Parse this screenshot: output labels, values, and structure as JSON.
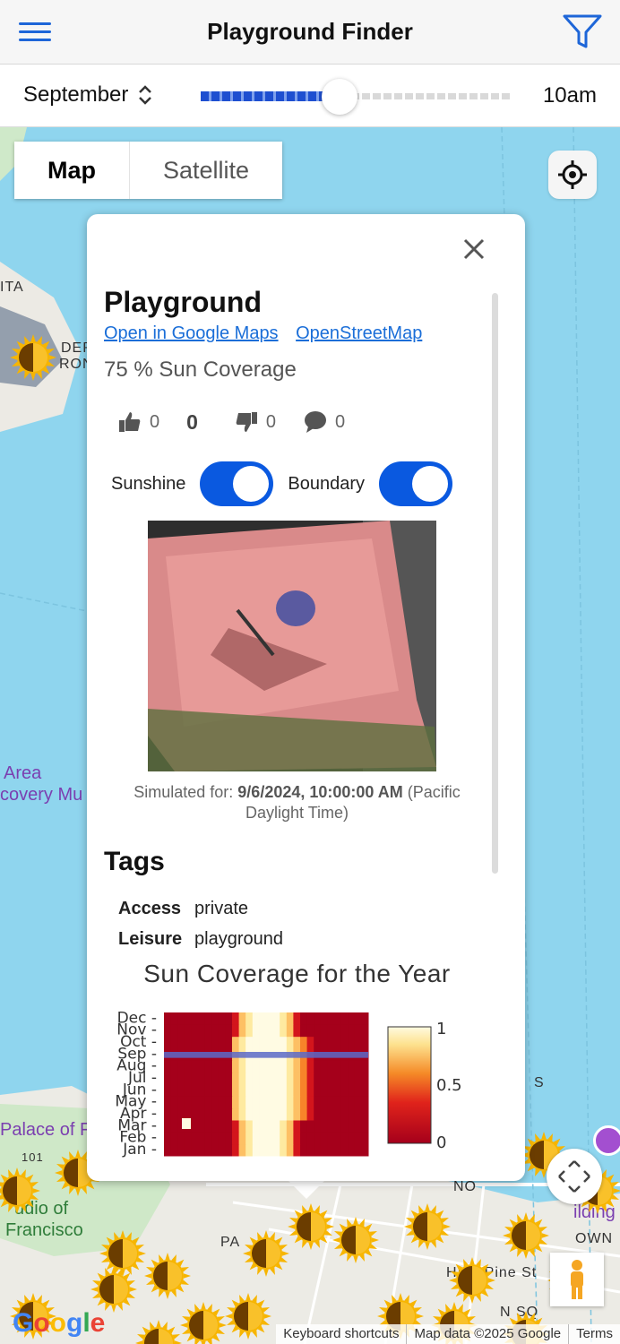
{
  "header": {
    "title": "Playground Finder",
    "menu_icon": "hamburger-icon",
    "filter_icon": "filter-icon"
  },
  "time_bar": {
    "month": "September",
    "time": "10am",
    "slider_fraction": 0.43
  },
  "map": {
    "map_type": [
      "Map",
      "Satellite"
    ],
    "active_map_type": "Map",
    "labels": {
      "area": "Area",
      "covery": "covery Mu",
      "palace": "Palace of F",
      "studio": "udio of",
      "francisco": "Francisco",
      "hill": "HILL Pine St",
      "ita": "ITA",
      "pa": "PA",
      "deri": "DER",
      "ron": "RON",
      "no": "NO",
      "own": "OWN",
      "nsq": "N SQ",
      "s": "S",
      "ilding": "ilding",
      "route": "101"
    },
    "attribution": {
      "shortcuts": "Keyboard shortcuts",
      "data": "Map data ©2025 Google",
      "terms": "Terms"
    },
    "logo": "Google"
  },
  "popup": {
    "title": "Playground",
    "links": [
      "Open in Google Maps",
      "OpenStreetMap"
    ],
    "coverage": "75 % Sun Coverage",
    "votes": {
      "up": "0",
      "total": "0",
      "down": "0",
      "comments": "0"
    },
    "toggles": {
      "sunshine_label": "Sunshine",
      "boundary_label": "Boundary",
      "sunshine_on": true,
      "boundary_on": true
    },
    "caption_prefix": "Simulated for: ",
    "caption_date": "9/6/2024, 10:00:00 AM",
    "caption_suffix": " (Pacific Daylight Time)",
    "tags_title": "Tags",
    "tags": [
      {
        "key": "Access",
        "value": "private"
      },
      {
        "key": "Leisure",
        "value": "playground"
      }
    ]
  },
  "chart_data": {
    "type": "heatmap",
    "title": "Sun Coverage for the Year",
    "rows": [
      "Jan",
      "Feb",
      "Mar",
      "Apr",
      "May",
      "Jun",
      "Jul",
      "Aug",
      "Sep",
      "Oct",
      "Nov",
      "Dec"
    ],
    "highlight_row": "Sep",
    "colorbar": {
      "min": 0,
      "max": 1,
      "ticks": [
        "1",
        "0.5",
        "0"
      ]
    }
  }
}
